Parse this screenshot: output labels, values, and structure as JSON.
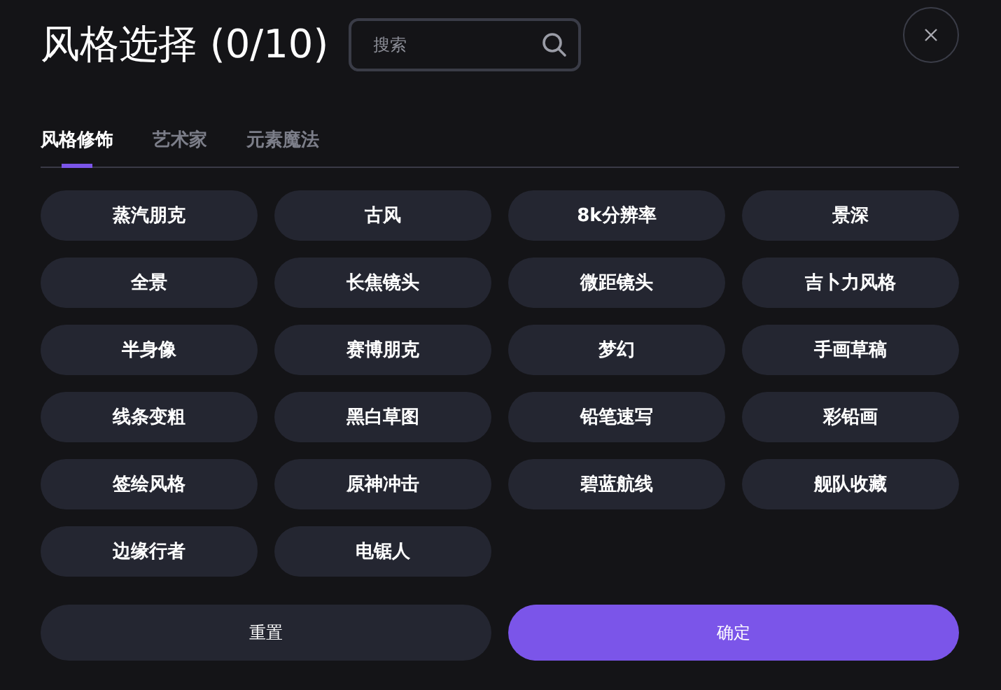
{
  "title": "风格选择 (0/10)",
  "search": {
    "placeholder": "搜索"
  },
  "tabs": [
    {
      "label": "风格修饰",
      "selected": true
    },
    {
      "label": "艺术家",
      "selected": false
    },
    {
      "label": "元素魔法",
      "selected": false
    }
  ],
  "styles": [
    {
      "label": "蒸汽朋克",
      "selected": false
    },
    {
      "label": "古风",
      "selected": false
    },
    {
      "label": "8k分辨率",
      "selected": false
    },
    {
      "label": "景深",
      "selected": false
    },
    {
      "label": "全景",
      "selected": false
    },
    {
      "label": "长焦镜头",
      "selected": false
    },
    {
      "label": "微距镜头",
      "selected": false
    },
    {
      "label": "吉卜力风格",
      "selected": false
    },
    {
      "label": "半身像",
      "selected": false
    },
    {
      "label": "赛博朋克",
      "selected": false
    },
    {
      "label": "梦幻",
      "selected": false
    },
    {
      "label": "手画草稿",
      "selected": false
    },
    {
      "label": "线条变粗",
      "selected": false
    },
    {
      "label": "黑白草图",
      "selected": false
    },
    {
      "label": "铅笔速写",
      "selected": false
    },
    {
      "label": "彩铅画",
      "selected": false
    },
    {
      "label": "签绘风格",
      "selected": false
    },
    {
      "label": "原神冲击",
      "selected": false
    },
    {
      "label": "碧蓝航线",
      "selected": false
    },
    {
      "label": "舰队收藏",
      "selected": false
    },
    {
      "label": "边缘行者",
      "selected": false
    },
    {
      "label": "电锯人",
      "selected": false
    }
  ],
  "buttons": [
    {
      "label": "重置",
      "kind": "secondary"
    },
    {
      "label": "确定",
      "kind": "primary"
    }
  ]
}
